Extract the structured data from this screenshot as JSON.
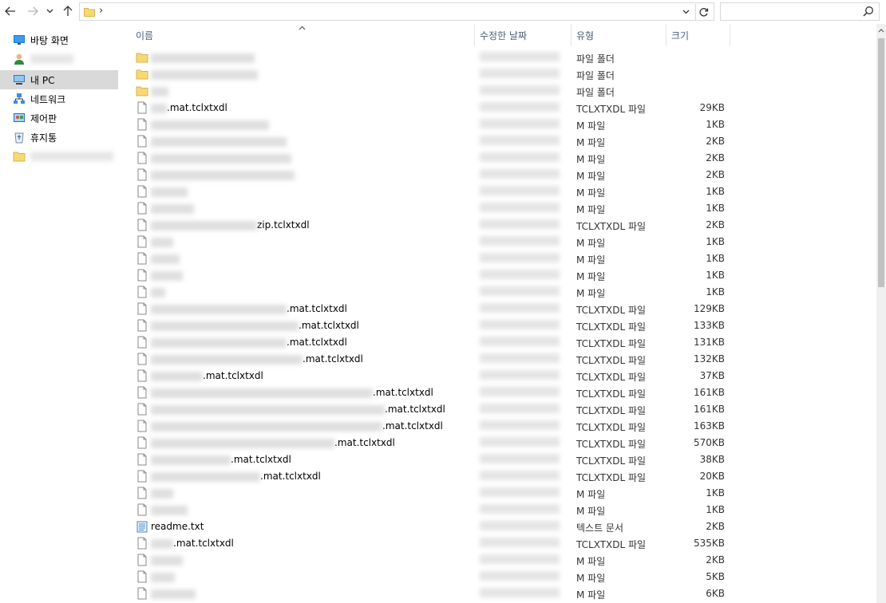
{
  "toolbar": {
    "back_icon": "arrow-left-icon",
    "forward_icon": "arrow-right-icon",
    "recent_icon": "chevron-down-icon",
    "up_icon": "arrow-up-icon"
  },
  "address": {
    "separator": "›",
    "path": "",
    "dropdown_glyph": "∨",
    "refresh_glyph": "↻"
  },
  "search": {
    "placeholder": ""
  },
  "sidebar": {
    "items": [
      {
        "label": "바탕 화면",
        "icon": "desktop-icon"
      },
      {
        "label": "",
        "icon": "user-icon"
      },
      {
        "label": "내 PC",
        "icon": "pc-icon",
        "selected": true
      },
      {
        "label": "네트워크",
        "icon": "network-icon"
      },
      {
        "label": "제어판",
        "icon": "control-panel-icon"
      },
      {
        "label": "휴지통",
        "icon": "recycle-bin-icon"
      },
      {
        "label": "",
        "icon": "folder-icon"
      }
    ]
  },
  "columns": {
    "name": "이름",
    "modified": "수정한 날짜",
    "type": "유형",
    "size": "크기"
  },
  "files": [
    {
      "icon": "folder",
      "name": "",
      "type": "파일 폴더",
      "size": ""
    },
    {
      "icon": "folder",
      "name": "",
      "type": "파일 폴더",
      "size": ""
    },
    {
      "icon": "folder",
      "name": "",
      "type": "파일 폴더",
      "size": ""
    },
    {
      "icon": "file",
      "name": ".mat.tclxtxdl",
      "type": "TCLXTXDL 파일",
      "size": "29KB"
    },
    {
      "icon": "file",
      "name": "",
      "type": "M 파일",
      "size": "1KB"
    },
    {
      "icon": "file",
      "name": "",
      "type": "M 파일",
      "size": "2KB"
    },
    {
      "icon": "file",
      "name": "",
      "type": "M 파일",
      "size": "2KB"
    },
    {
      "icon": "file",
      "name": "",
      "type": "M 파일",
      "size": "2KB"
    },
    {
      "icon": "file",
      "name": "",
      "type": "M 파일",
      "size": "1KB"
    },
    {
      "icon": "file",
      "name": "",
      "type": "M 파일",
      "size": "1KB"
    },
    {
      "icon": "file",
      "name": "zip.tclxtxdl",
      "type": "TCLXTXDL 파일",
      "size": "2KB"
    },
    {
      "icon": "file",
      "name": "",
      "type": "M 파일",
      "size": "1KB"
    },
    {
      "icon": "file",
      "name": "",
      "type": "M 파일",
      "size": "1KB"
    },
    {
      "icon": "file",
      "name": "",
      "type": "M 파일",
      "size": "1KB"
    },
    {
      "icon": "file",
      "name": "",
      "type": "M 파일",
      "size": "1KB"
    },
    {
      "icon": "file",
      "name": ".mat.tclxtxdl",
      "type": "TCLXTXDL 파일",
      "size": "129KB"
    },
    {
      "icon": "file",
      "name": ".mat.tclxtxdl",
      "type": "TCLXTXDL 파일",
      "size": "133KB"
    },
    {
      "icon": "file",
      "name": ".mat.tclxtxdl",
      "type": "TCLXTXDL 파일",
      "size": "131KB"
    },
    {
      "icon": "file",
      "name": ".mat.tclxtxdl",
      "type": "TCLXTXDL 파일",
      "size": "132KB"
    },
    {
      "icon": "file",
      "name": ".mat.tclxtxdl",
      "type": "TCLXTXDL 파일",
      "size": "37KB"
    },
    {
      "icon": "file",
      "name": ".mat.tclxtxdl",
      "type": "TCLXTXDL 파일",
      "size": "161KB"
    },
    {
      "icon": "file",
      "name": ".mat.tclxtxdl",
      "type": "TCLXTXDL 파일",
      "size": "161KB"
    },
    {
      "icon": "file",
      "name": ".mat.tclxtxdl",
      "type": "TCLXTXDL 파일",
      "size": "163KB"
    },
    {
      "icon": "file",
      "name": ".mat.tclxtxdl",
      "type": "TCLXTXDL 파일",
      "size": "570KB"
    },
    {
      "icon": "file",
      "name": ".mat.tclxtxdl",
      "type": "TCLXTXDL 파일",
      "size": "38KB"
    },
    {
      "icon": "file",
      "name": ".mat.tclxtxdl",
      "type": "TCLXTXDL 파일",
      "size": "20KB"
    },
    {
      "icon": "file",
      "name": "",
      "type": "M 파일",
      "size": "1KB"
    },
    {
      "icon": "file",
      "name": "",
      "type": "M 파일",
      "size": "1KB"
    },
    {
      "icon": "text",
      "name": "readme.txt",
      "type": "텍스트 문서",
      "size": "2KB"
    },
    {
      "icon": "file",
      "name": ".mat.tclxtxdl",
      "type": "TCLXTXDL 파일",
      "size": "535KB"
    },
    {
      "icon": "file",
      "name": "",
      "type": "M 파일",
      "size": "2KB"
    },
    {
      "icon": "file",
      "name": "",
      "type": "M 파일",
      "size": "5KB"
    },
    {
      "icon": "file",
      "name": "",
      "type": "M 파일",
      "size": "6KB"
    }
  ],
  "colors": {
    "folder": "#f8d775",
    "selected_bg": "#d9d9d9",
    "header_text": "#4c607a"
  }
}
